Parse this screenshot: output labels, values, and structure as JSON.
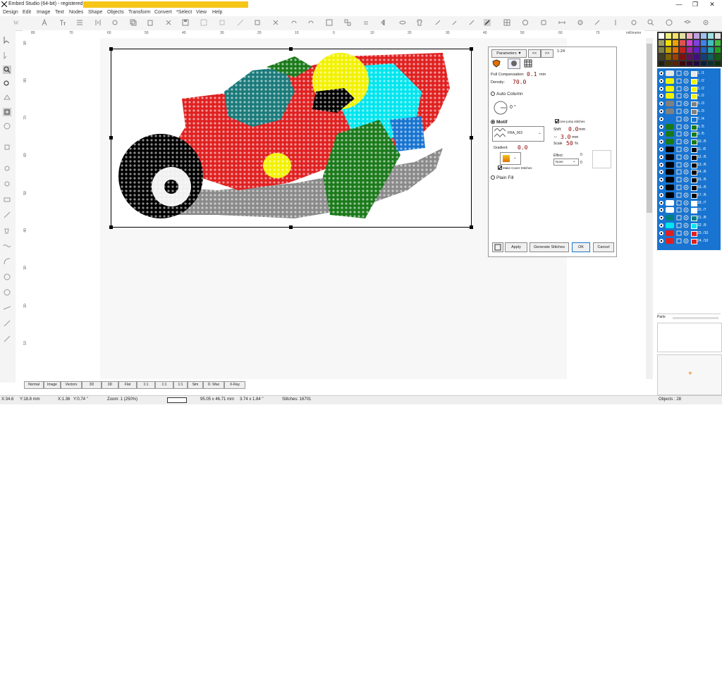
{
  "title": {
    "text": "Embird Studio (64-bit) - registered to"
  },
  "window": {
    "minimize": "—",
    "maximize": "❐",
    "close": "✕"
  },
  "menu": [
    "Design",
    "Edit",
    "Image",
    "Text",
    "Nodes",
    "Shape",
    "Objects",
    "Transform",
    "Convert",
    "*Select",
    "View",
    "Help"
  ],
  "ruler": {
    "unit": "millimeter",
    "h_ticks": [
      "80",
      "70",
      "60",
      "50",
      "40",
      "30",
      "20",
      "10",
      "0",
      "10",
      "20",
      "30",
      "40",
      "50",
      "60",
      "70"
    ],
    "v_ticks": [
      "90",
      "80",
      "70",
      "60",
      "50",
      "40",
      "30",
      "20",
      "10"
    ]
  },
  "params": {
    "dropdown": "Parameters ▼",
    "nav_prev": "<<",
    "nav_next": ">>",
    "range": "1-24",
    "pull_comp_label": "Pull Compensation:",
    "pull_comp_value": "0.1",
    "pull_comp_unit": "mm",
    "density_label": "Density:",
    "density_value": "70.0",
    "auto_column": "Auto Column",
    "angle": "0 °",
    "motif": "Motif",
    "motif_pattern": "FRA_002",
    "use_jump": "Use jump stitches",
    "shift_label": "Shift:",
    "shift_value": "0.0",
    "shift_unit": "mm",
    "spacing_value": "3.0",
    "spacing_unit": "mm",
    "scale_label": "Scale",
    "scale_value": "50",
    "scale_unit": "%",
    "gradient_label": "Gradient:",
    "gradient_value": "0.0",
    "effect_label": "Effect:",
    "effect_value": "None",
    "effect_n1": "0",
    "effect_n2": "0",
    "make_cover": "Make Cover Stitches",
    "plain_fill": "Plain Fill",
    "apply": "Apply",
    "generate": "Generate Stitches",
    "ok": "OK",
    "cancel": "Cancel"
  },
  "objects": [
    {
      "label": "1. /1",
      "color": "#e6e6e6"
    },
    {
      "label": "2. /2",
      "color": "#f2f200"
    },
    {
      "label": "3. /2",
      "color": "#f2f200"
    },
    {
      "label": "4. /2",
      "color": "#f2f200"
    },
    {
      "label": "5. /3",
      "color": "#808080"
    },
    {
      "label": "6. /3",
      "color": "#808080"
    },
    {
      "label": "7. /4",
      "color": "#1874d0"
    },
    {
      "label": "8. /5",
      "color": "#1a7a1a"
    },
    {
      "label": "9. /5",
      "color": "#1a7a1a"
    },
    {
      "label": "10. /5",
      "color": "#1a7a1a"
    },
    {
      "label": "11. /6",
      "color": "#000"
    },
    {
      "label": "12. /6",
      "color": "#000"
    },
    {
      "label": "13. /6",
      "color": "#000"
    },
    {
      "label": "14. /6",
      "color": "#000"
    },
    {
      "label": "15. /6",
      "color": "#000"
    },
    {
      "label": "16. /6",
      "color": "#000"
    },
    {
      "label": "17. /6",
      "color": "#000"
    },
    {
      "label": "18. /7",
      "color": "#fff"
    },
    {
      "label": "20. /7",
      "color": "#fff"
    },
    {
      "label": "21. /8",
      "color": "#008080"
    },
    {
      "label": "22. /9",
      "color": "#00e5ee"
    },
    {
      "label": "23. /10",
      "color": "#e02020"
    },
    {
      "label": "24. /10",
      "color": "#e02020"
    }
  ],
  "parts_label": "Parts",
  "tabs": [
    "Normal",
    "Image",
    "Vectors",
    "3D",
    "3D",
    "Flat",
    "1:1",
    "1:1",
    "1:1",
    "Sim",
    "D. Wax",
    "X-Ray"
  ],
  "status": {
    "x": "X:34.6",
    "y": "Y:18.8 mm",
    "dx": "X:1.36",
    "dy": "Y:0.74 \"",
    "zoom": "Zoom:  1 (250%)",
    "size_mm": "95.05 x 46.71 mm",
    "size_in": "3.74 x 1.84 \"",
    "stitches": "Stitches:  16701",
    "objects": "Objects : 28"
  },
  "colors": {
    "accent": "#1874d0",
    "red": "#e02020",
    "yellow": "#f2f200",
    "cyan": "#00e5ee",
    "teal": "#008080",
    "green": "#1a7a1a",
    "black": "#000000",
    "gray": "#808080"
  }
}
